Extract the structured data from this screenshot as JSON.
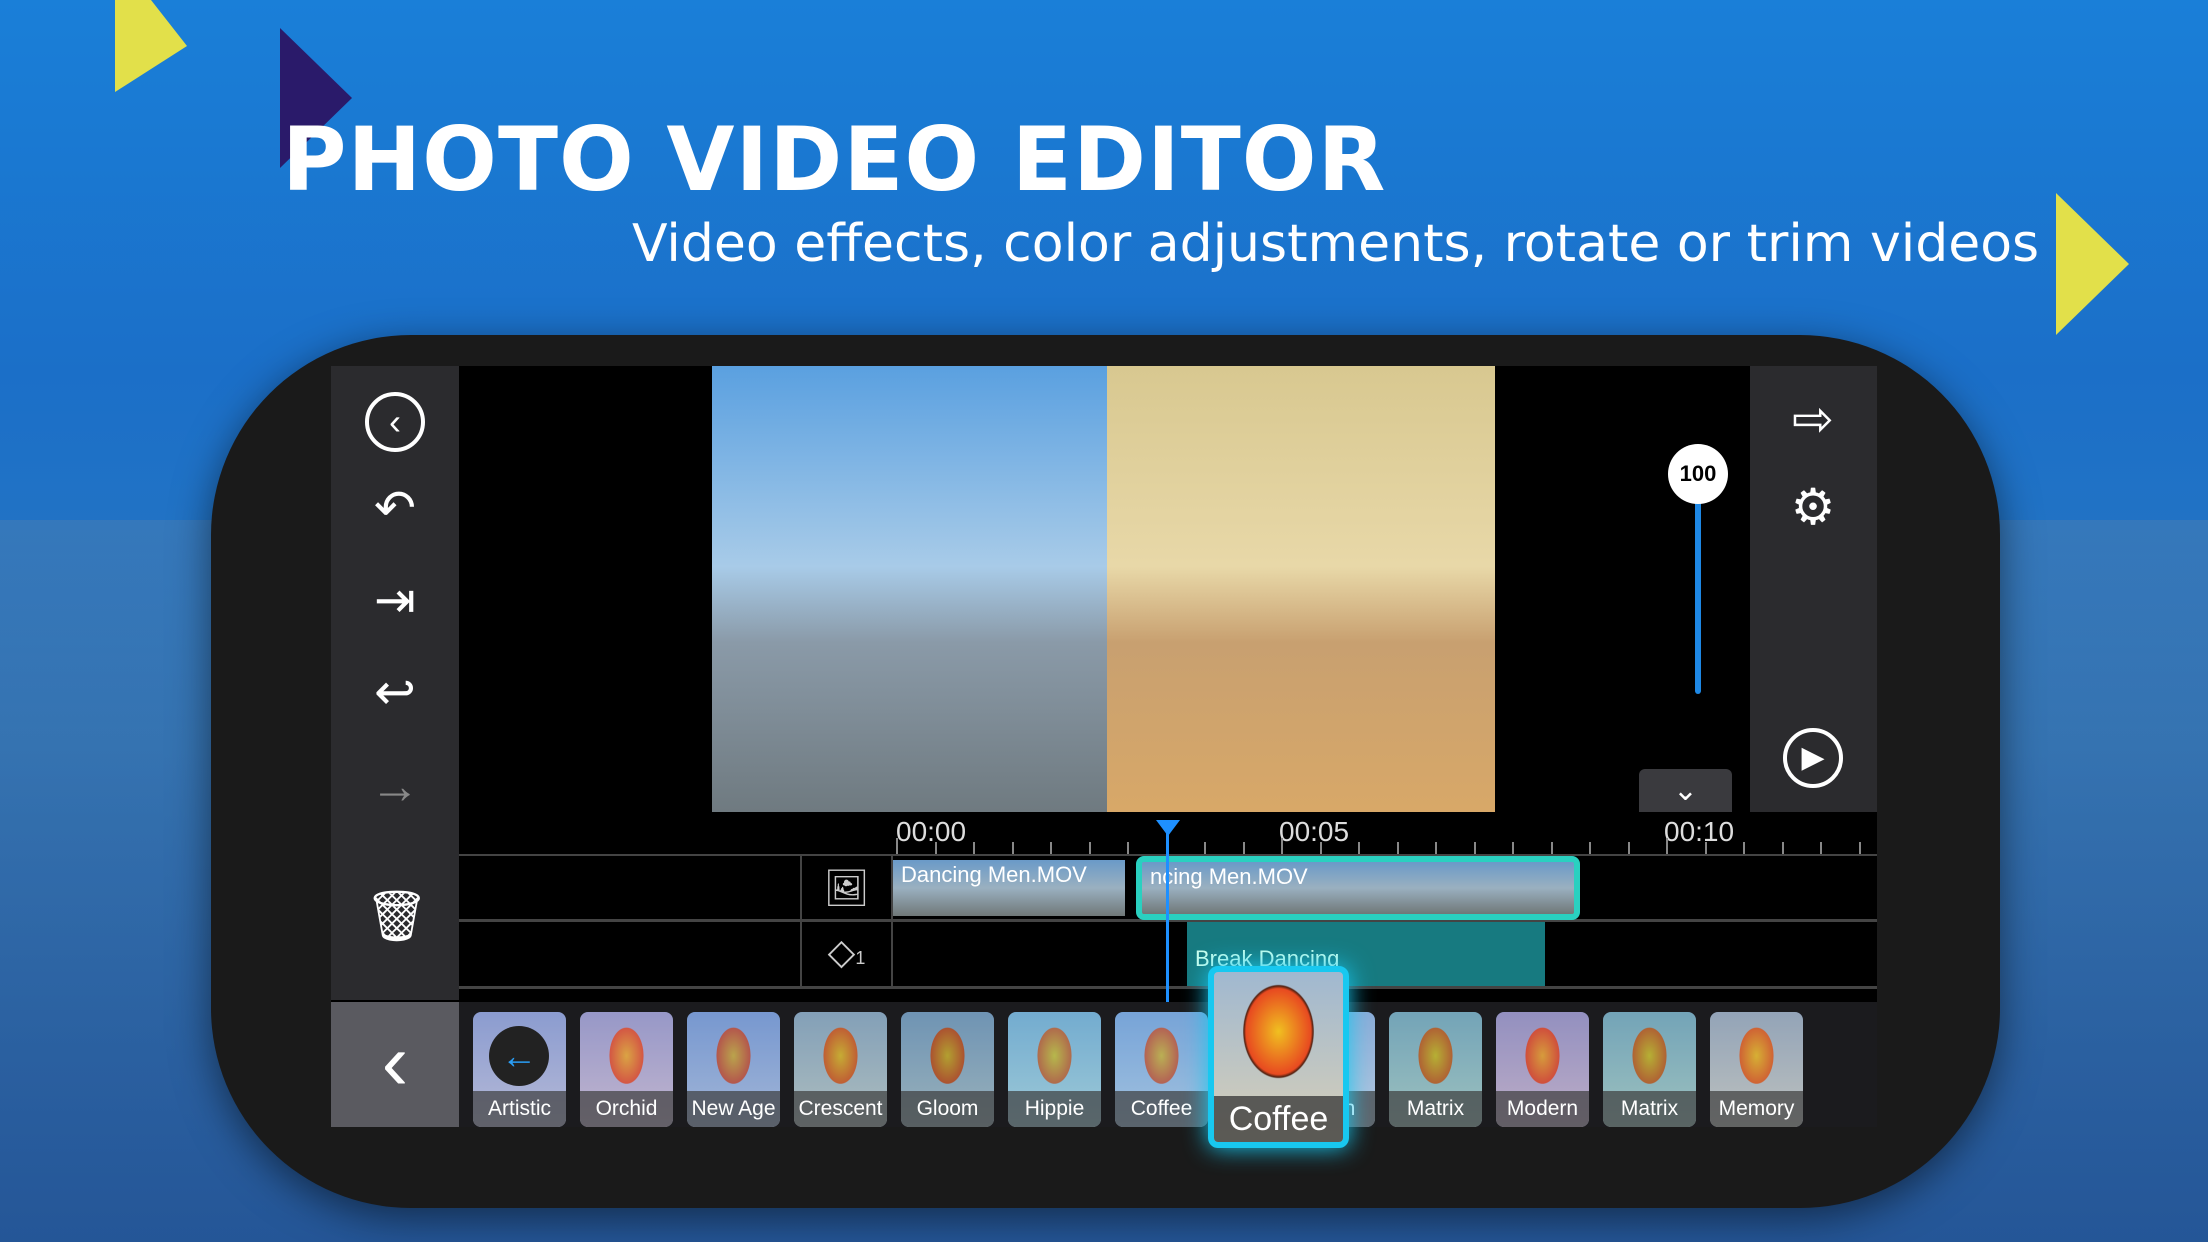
{
  "banner": {
    "title": "PHOTO VIDEO EDITOR",
    "subtitle": "Video effects, color adjustments, rotate or trim videos"
  },
  "colors": {
    "accent": "#1e90ff",
    "selection": "#2ad0c0",
    "highlight": "#18c8f0",
    "triangle_yellow": "#e2e04a",
    "triangle_purple": "#2a1a6a"
  },
  "left_toolbar": [
    "back-circle-icon",
    "undo-icon",
    "import-icon",
    "reply-icon",
    "redo-icon",
    "trash-icon"
  ],
  "right_toolbar": [
    "export-icon",
    "settings-icon",
    "play-icon"
  ],
  "slider": {
    "value": "100"
  },
  "timeline": {
    "ticks": [
      "00:00",
      "00:05",
      "00:10"
    ],
    "clips": [
      {
        "name": "Dancing Men.MOV"
      },
      {
        "name": "ncing Men.MOV"
      }
    ],
    "overlay_layer": {
      "label": "Break Dancing",
      "count": "1"
    }
  },
  "filters": [
    {
      "label": "Artistic"
    },
    {
      "label": "Orchid"
    },
    {
      "label": "New Age"
    },
    {
      "label": "Crescent"
    },
    {
      "label": "Gloom"
    },
    {
      "label": "Hippie"
    },
    {
      "label": "Coffee"
    },
    {
      "label": "odern"
    },
    {
      "label": "Matrix"
    },
    {
      "label": "Modern"
    },
    {
      "label": "Matrix"
    },
    {
      "label": "Memory"
    }
  ],
  "selected_filter": {
    "label": "Coffee"
  }
}
